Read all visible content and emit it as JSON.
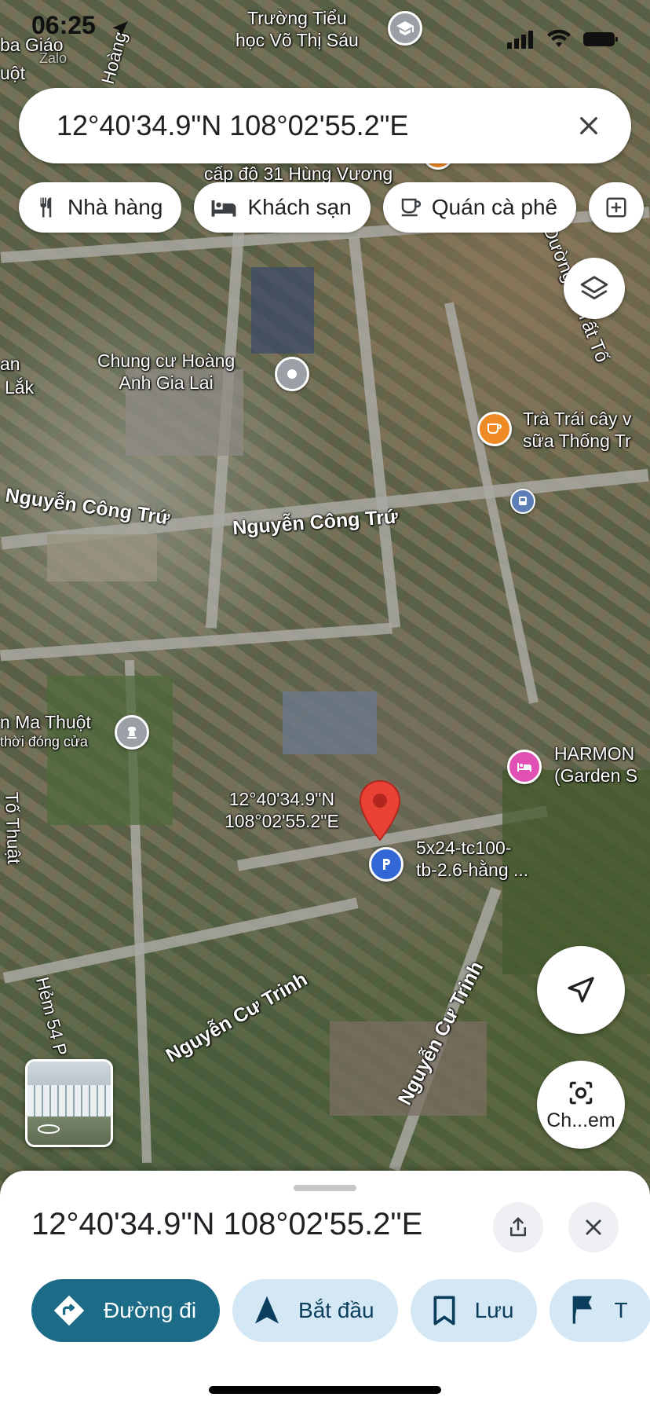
{
  "status_bar": {
    "time": "06:25"
  },
  "search": {
    "query": "12°40'34.9\"N 108°02'55.2\"E"
  },
  "chips": [
    {
      "label": "Nhà hàng",
      "icon": "restaurant-icon"
    },
    {
      "label": "Khách sạn",
      "icon": "hotel-icon"
    },
    {
      "label": "Quán cà phê",
      "icon": "coffee-icon"
    }
  ],
  "map": {
    "labels": {
      "school_line1": "Trường Tiểu",
      "school_line2": "học Võ Thị Sáu",
      "top_left_1": "ba Giáo",
      "top_left_2": "Zalo",
      "top_left_3": "uột",
      "top_left_road": "Hoàng",
      "top_center": "cấp độ 31 Hùng Vương",
      "apartment_line1": "Chung cư Hoàng",
      "apartment_line2": "Anh Gia Lai",
      "left_1": "an",
      "left_2": "Lắk",
      "tea_line1": "Trà Trái cây v",
      "tea_line2": "sữa Thống Tr",
      "right_road": "Đường Tô Tất Tố",
      "road_ncong_left": "Nguyễn Công Trứ",
      "road_ncong_center": "Nguyễn Công Trứ",
      "museum_line1": "n Ma Thuột",
      "museum_line2": "thời đóng cửa",
      "hotel_line1": "HARMON",
      "hotel_line2": "(Garden S",
      "pin_coord_line1": "12°40'34.9\"N",
      "pin_coord_line2": "108°02'55.2\"E",
      "parking_line1": "5x24-tc100-",
      "parking_line2": "tb-2.6-hằng ...",
      "left_vertical": "Tố Thuật",
      "alley": "Hẻm 54 P",
      "road_ncu_1": "Nguyễn Cư Trinh",
      "road_ncu_2": "Nguyễn Cư Trinh"
    }
  },
  "buttons": {
    "lens_label": "Ch...em"
  },
  "sheet": {
    "title": "12°40'34.9\"N 108°02'55.2\"E",
    "actions": [
      {
        "label": "Đường đi",
        "icon": "directions-icon"
      },
      {
        "label": "Bắt đầu",
        "icon": "navigation-arrow-icon"
      },
      {
        "label": "Lưu",
        "icon": "bookmark-icon"
      },
      {
        "label": "T",
        "icon": "flag-icon"
      }
    ]
  },
  "colors": {
    "primary": "#1c6b87",
    "action_bg": "#d3e7f4",
    "pin_red": "#e94235",
    "hotel_pink": "#e04fb4",
    "cafe_orange": "#f08a24",
    "parking_blue": "#3367d6"
  }
}
